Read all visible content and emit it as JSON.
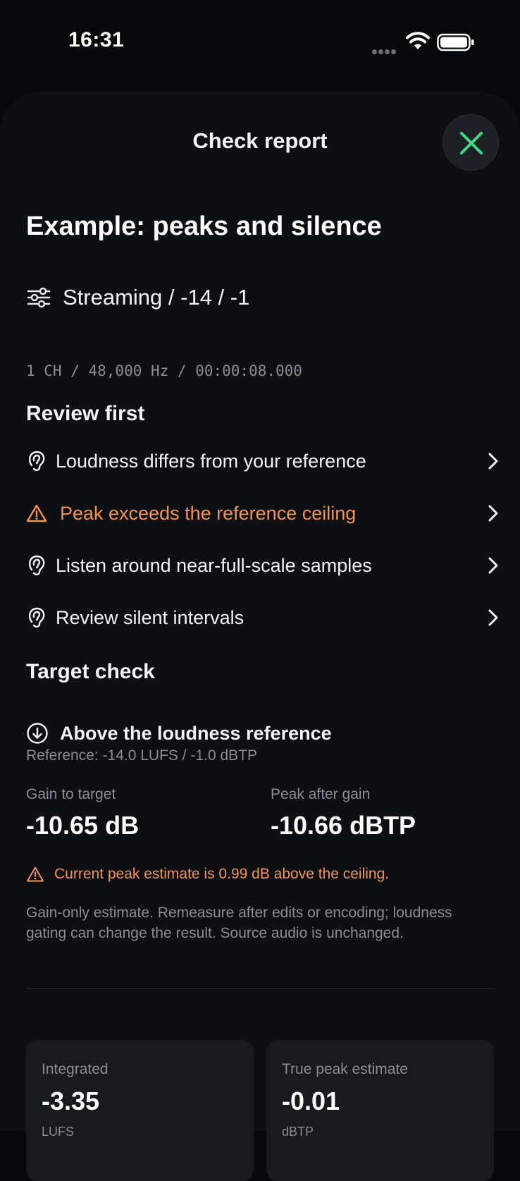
{
  "status_bar": {
    "time": "16:31"
  },
  "sheet": {
    "title": "Check report",
    "close_icon": "x-mark-icon"
  },
  "report": {
    "title": "Example: peaks and silence",
    "preset": "Streaming / -14 / -1",
    "format_line": "1 CH / 48,000 Hz / 00:00:08.000"
  },
  "review": {
    "heading": "Review first",
    "items": [
      {
        "label": "Loudness differs from your reference",
        "icon": "ear-icon",
        "severity": "info"
      },
      {
        "label": "Peak exceeds the reference ceiling",
        "icon": "warning-triangle-icon",
        "severity": "warning"
      },
      {
        "label": "Listen around near-full-scale samples",
        "icon": "ear-icon",
        "severity": "info"
      },
      {
        "label": "Review silent intervals",
        "icon": "ear-icon",
        "severity": "info"
      }
    ]
  },
  "target": {
    "heading": "Target check",
    "status": "Above the loudness reference",
    "reference": "Reference: -14.0 LUFS / -1.0 dBTP",
    "gain_label": "Gain to target",
    "gain_value": "-10.65 dB",
    "peak_label": "Peak after gain",
    "peak_value": "-10.66 dBTP",
    "warning": "Current peak estimate is 0.99 dB above the ceiling.",
    "disclaimer": "Gain-only estimate. Remeasure after edits or encoding; loudness gating can change the result. Source audio is unchanged."
  },
  "stats": [
    {
      "label": "Integrated",
      "value": "-3.35",
      "unit": "LUFS"
    },
    {
      "label": "True peak estimate",
      "value": "-0.01",
      "unit": "dBTP"
    }
  ],
  "colors": {
    "background": "#08090b",
    "sheet": "#0d0f12",
    "warning": "#f3944c",
    "accent_green": "#3ddc84",
    "muted_text": "#8a8d93"
  }
}
